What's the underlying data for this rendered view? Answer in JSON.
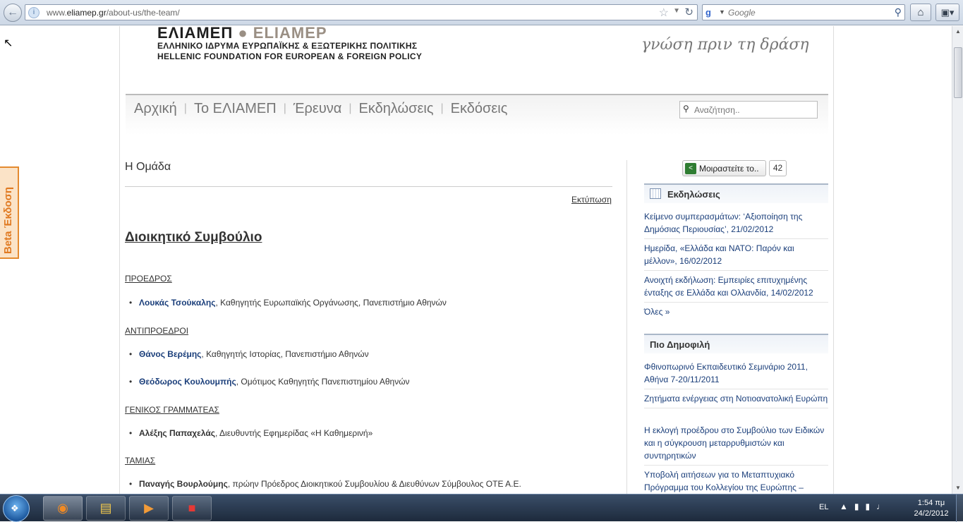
{
  "browser": {
    "url_prefix": "www.",
    "url_domain": "eliamep.gr",
    "url_path": "/about-us/the-team/",
    "search_engine": "Google",
    "search_placeholder": "Google"
  },
  "header": {
    "logo_greek": "ΕΛΙΑΜΕΠ",
    "logo_latin": "ELIAMEP",
    "subtitle_greek": "ΕΛΛΗΝΙΚΟ ΙΔΡΥΜΑ ΕΥΡΩΠΑΪΚΗΣ & ΕΞΩΤΕΡΙΚΗΣ ΠΟΛΙΤΙΚΗΣ",
    "subtitle_english": "HELLENIC FOUNDATION FOR EUROPEAN & FOREIGN POLICY",
    "tagline": "γνώση πριν τη δράση"
  },
  "nav": {
    "items": [
      "Αρχική",
      "Το ΕΛΙΑΜΕΠ",
      "Έρευνα",
      "Εκδηλώσεις",
      "Εκδόσεις"
    ],
    "search_placeholder": "Αναζήτηση.."
  },
  "beta_tab": {
    "label": "Beta Έκδοση"
  },
  "main": {
    "title": "Η Ομάδα",
    "print_label": "Εκτύπωση",
    "section_title": "Διοικητικό Συμβούλιο",
    "roles": [
      {
        "title": "ΠΡΟΕΔΡΟΣ",
        "members": [
          {
            "name": "Λουκάς Τσούκαλης",
            "desc": ", Καθηγητής Ευρωπαϊκής Οργάνωσης, Πανεπιστήμιο Αθηνών",
            "linked": true
          }
        ]
      },
      {
        "title": "ΑΝΤΙΠΡΟΕΔΡΟΙ",
        "members": [
          {
            "name": "Θάνος Βερέμης",
            "desc": ", Καθηγητής Ιστορίας, Πανεπιστήμιο Αθηνών",
            "linked": true
          },
          {
            "name": "Θεόδωρος Κουλουμπής",
            "desc": ", Ομότιμος Καθηγητής Πανεπιστημίου Αθηνών",
            "linked": true
          }
        ]
      },
      {
        "title": "ΓΕΝΙΚΟΣ ΓΡΑΜΜΑΤΕΑΣ",
        "members": [
          {
            "name": "Αλέξης Παπαχελάς",
            "desc": ", Διευθυντής Εφημερίδας «Η Καθημερινή»",
            "linked": false
          }
        ]
      },
      {
        "title": "ΤΑΜΙΑΣ",
        "members": [
          {
            "name": "Παναγής Βουρλούμης",
            "desc": ", πρώην Πρόεδρος Διοικητικού Συμβουλίου & Διευθύνων Σύμβουλος ΟΤΕ Α.Ε.",
            "linked": false
          }
        ]
      }
    ]
  },
  "sidebar": {
    "share_label": "Μοιραστείτε το..",
    "share_count": "42",
    "events_title": "Εκδηλώσεις",
    "events": [
      "Κείμενο συμπερασμάτων: ‘Αξιοποίηση της Δημόσιας Περιουσίας’, 21/02/2012",
      "Ημερίδα, «Ελλάδα και ΝΑΤΟ: Παρόν και μέλλον», 16/02/2012",
      "Ανοιχτή εκδήλωση: Εμπειρίες επιτυχημένης ένταξης σε Ελλάδα και Ολλανδία, 14/02/2012"
    ],
    "events_all": "Όλες »",
    "popular_title": "Πιο Δημοφιλή",
    "popular": [
      "Φθινοπωρινό Εκπαιδευτικό Σεμινάριο 2011, Αθήνα 7-20/11/2011",
      "Ζητήματα ενέργειας στη Νοτιοανατολική Ευρώπη",
      "Η εκλογή προέδρου στο Συμβούλιο των Ειδικών και η σύγκρουση μεταρρυθμιστών και συντηρητικών",
      "Υποβολή αιτήσεων για το Μεταπτυχιακό Πρόγραμμα του Κολλεγίου της Ευρώπης –"
    ]
  },
  "taskbar": {
    "language": "EL",
    "time": "1:54 πμ",
    "date": "24/2/2012"
  }
}
